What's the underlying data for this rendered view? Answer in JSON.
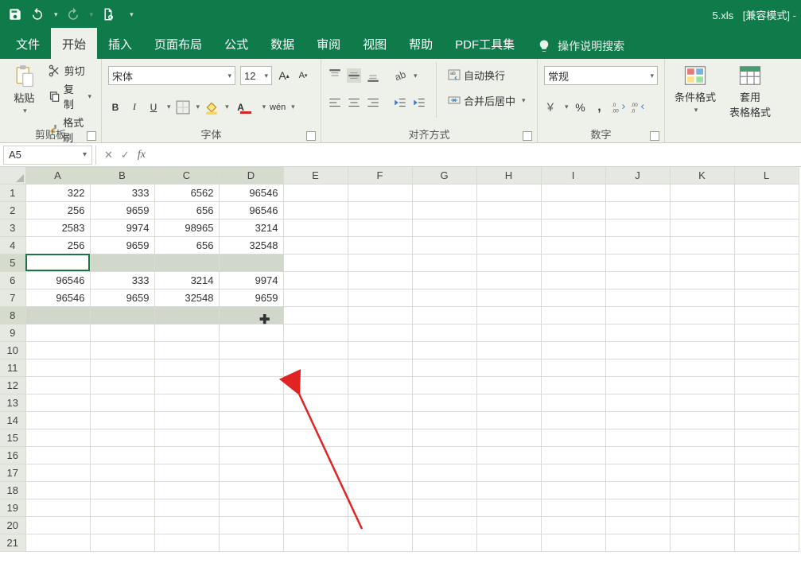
{
  "titlebar": {
    "filename": "5.xls",
    "mode": "[兼容模式]",
    "dash": " - "
  },
  "tabs": {
    "file": "文件",
    "home": "开始",
    "insert": "插入",
    "layout": "页面布局",
    "formula": "公式",
    "data": "数据",
    "review": "审阅",
    "view": "视图",
    "help": "帮助",
    "pdf": "PDF工具集",
    "tell": "操作说明搜索"
  },
  "ribbon": {
    "clipboard": {
      "paste": "粘贴",
      "cut": "剪切",
      "copy": "复制",
      "painter": "格式刷",
      "label": "剪贴板"
    },
    "font": {
      "family": "宋体",
      "size": "12",
      "label": "字体"
    },
    "align": {
      "wrap": "自动换行",
      "merge": "合并后居中",
      "label": "对齐方式"
    },
    "number": {
      "format": "常规",
      "label": "数字"
    },
    "styles": {
      "cond": "条件格式",
      "tablefmt": "套用\n表格格式"
    }
  },
  "namebox": "A5",
  "fx_content": "",
  "columns": [
    "A",
    "B",
    "C",
    "D",
    "E",
    "F",
    "G",
    "H",
    "I",
    "J",
    "K",
    "L"
  ],
  "selectedCols": [
    "A",
    "B",
    "C",
    "D"
  ],
  "rows": [
    1,
    2,
    3,
    4,
    5,
    6,
    7,
    8,
    9,
    10,
    11,
    12,
    13,
    14,
    15,
    16,
    17,
    18,
    19,
    20,
    21
  ],
  "selectedRowHeaders": [
    5,
    8
  ],
  "chart_data": {
    "type": "table",
    "columns": [
      "A",
      "B",
      "C",
      "D"
    ],
    "cells": {
      "1": {
        "A": "322",
        "B": "333",
        "C": "6562",
        "D": "96546"
      },
      "2": {
        "A": "256",
        "B": "9659",
        "C": "656",
        "D": "96546"
      },
      "3": {
        "A": "2583",
        "B": "9974",
        "C": "98965",
        "D": "3214"
      },
      "4": {
        "A": "256",
        "B": "9659",
        "C": "656",
        "D": "32548"
      },
      "5": {
        "A": "",
        "B": "",
        "C": "",
        "D": ""
      },
      "6": {
        "A": "96546",
        "B": "333",
        "C": "3214",
        "D": "9974"
      },
      "7": {
        "A": "96546",
        "B": "9659",
        "C": "32548",
        "D": "9659"
      },
      "8": {
        "A": "",
        "B": "",
        "C": "",
        "D": ""
      }
    },
    "activeCell": "A5",
    "selectedRows": [
      5,
      8
    ]
  }
}
